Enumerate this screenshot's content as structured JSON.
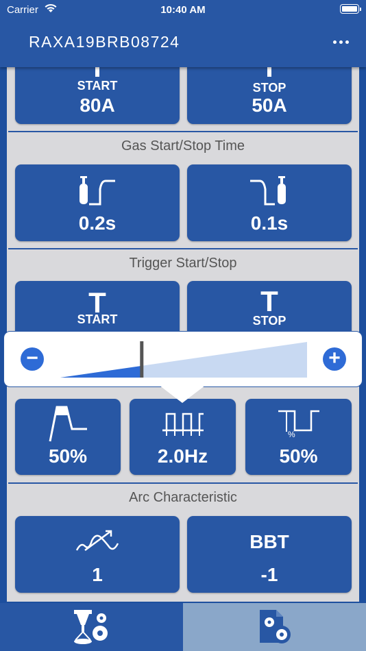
{
  "status": {
    "carrier": "Carrier",
    "time": "10:40 AM"
  },
  "header": {
    "title": "RAXA19BRB08724",
    "menu_icon": "more-icon"
  },
  "current": {
    "start_label": "START",
    "start_value": "80A",
    "stop_label": "STOP",
    "stop_value": "50A"
  },
  "gas": {
    "title": "Gas Start/Stop Time",
    "start_value": "0.2s",
    "stop_value": "0.1s"
  },
  "trigger": {
    "title": "Trigger Start/Stop",
    "start_letter": "T",
    "start_label": "START",
    "stop_letter": "T",
    "stop_label": "STOP"
  },
  "slider": {
    "minus": "−",
    "plus": "+",
    "level": 0.33
  },
  "pulse": {
    "peak_value": "50%",
    "freq_value": "2.0Hz",
    "duty_value": "50%",
    "duty_symbol": "%"
  },
  "arc": {
    "title": "Arc Characteristic",
    "char_value": "1",
    "bbt_label": "BBT",
    "bbt_value": "-1"
  },
  "tabs": [
    {
      "icon": "welding-settings-icon"
    },
    {
      "icon": "document-settings-icon"
    }
  ],
  "colors": {
    "primary": "#2857a4",
    "background": "#d9d9dc",
    "accent": "#2e6bd6",
    "active_tab": "#8aa7c9"
  }
}
